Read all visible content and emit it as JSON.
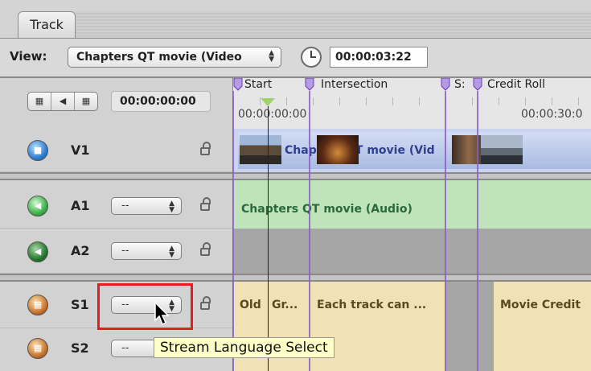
{
  "tab": {
    "label": "Track"
  },
  "view": {
    "label": "View:",
    "selected": "Chapters QT movie (Video",
    "timecode": "00:00:03:22"
  },
  "header": {
    "timecode": "00:00:00:00",
    "ruler_start": "00:00:00:00",
    "ruler_mid": "00:00:30:0"
  },
  "chapters": [
    "Start",
    "Intersection",
    "S:",
    "Credit Roll"
  ],
  "tracks": [
    {
      "id": "V1",
      "kind": "video",
      "stream": "",
      "clip": "Chapters QT movie (Vid"
    },
    {
      "id": "A1",
      "kind": "audio",
      "stream": "--",
      "clip": "Chapters QT movie (Audio)"
    },
    {
      "id": "A2",
      "kind": "audio",
      "stream": "--",
      "clip": ""
    },
    {
      "id": "S1",
      "kind": "subtitle",
      "stream": "--",
      "clips": [
        "Old",
        "Gr...",
        "Each track can ...",
        "Movie Credit"
      ]
    },
    {
      "id": "S2",
      "kind": "subtitle",
      "stream": "--",
      "clips": []
    }
  ],
  "tooltip": "Stream Language Select",
  "colors": {
    "video_lane": "#c7d3ee",
    "audio_clip": "#bfe3bb",
    "subtitle_clip": "#f1e2b6",
    "chapter_marker": "#8a5fc4",
    "highlight": "#e02020"
  }
}
